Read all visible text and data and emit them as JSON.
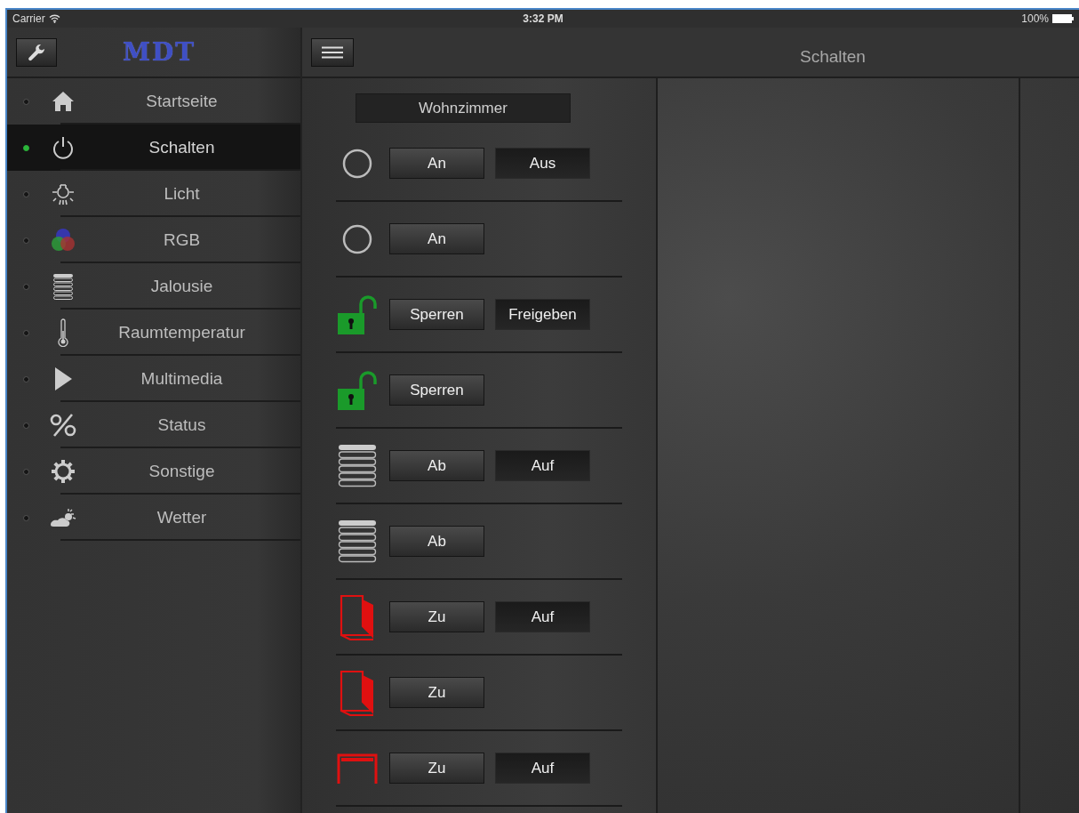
{
  "status_bar": {
    "carrier": "Carrier",
    "time": "3:32 PM",
    "battery": "100%"
  },
  "sidebar": {
    "logo": "MDT",
    "items": [
      {
        "label": "Startseite",
        "kind": "home",
        "selected": false
      },
      {
        "label": "Schalten",
        "kind": "power",
        "selected": true
      },
      {
        "label": "Licht",
        "kind": "bulb",
        "selected": false
      },
      {
        "label": "RGB",
        "kind": "rgb",
        "selected": false
      },
      {
        "label": "Jalousie",
        "kind": "blind",
        "selected": false
      },
      {
        "label": "Raumtemperatur",
        "kind": "thermometer",
        "selected": false
      },
      {
        "label": "Multimedia",
        "kind": "play",
        "selected": false
      },
      {
        "label": "Status",
        "kind": "percent",
        "selected": false
      },
      {
        "label": "Sonstige",
        "kind": "gear",
        "selected": false
      },
      {
        "label": "Wetter",
        "kind": "weather",
        "selected": false
      }
    ]
  },
  "nav_bar": {
    "title": "Schalten"
  },
  "room": "Wohnzimmer",
  "rows": [
    {
      "kind": "circle",
      "buttons": [
        {
          "label": "An",
          "kind": "raised"
        },
        {
          "label": "Aus",
          "kind": "dark"
        }
      ]
    },
    {
      "kind": "circle",
      "buttons": [
        {
          "label": "An",
          "kind": "raised"
        }
      ]
    },
    {
      "kind": "lock",
      "buttons": [
        {
          "label": "Sperren",
          "kind": "raised"
        },
        {
          "label": "Freigeben",
          "kind": "dark"
        }
      ]
    },
    {
      "kind": "lock",
      "buttons": [
        {
          "label": "Sperren",
          "kind": "raised"
        }
      ]
    },
    {
      "kind": "blind",
      "buttons": [
        {
          "label": "Ab",
          "kind": "raised"
        },
        {
          "label": "Auf",
          "kind": "dark"
        }
      ]
    },
    {
      "kind": "blind",
      "buttons": [
        {
          "label": "Ab",
          "kind": "raised"
        }
      ]
    },
    {
      "kind": "door",
      "buttons": [
        {
          "label": "Zu",
          "kind": "raised"
        },
        {
          "label": "Auf",
          "kind": "dark"
        }
      ]
    },
    {
      "kind": "door",
      "buttons": [
        {
          "label": "Zu",
          "kind": "raised"
        }
      ]
    },
    {
      "kind": "gate",
      "buttons": [
        {
          "label": "Zu",
          "kind": "raised"
        },
        {
          "label": "Auf",
          "kind": "dark"
        }
      ]
    }
  ]
}
